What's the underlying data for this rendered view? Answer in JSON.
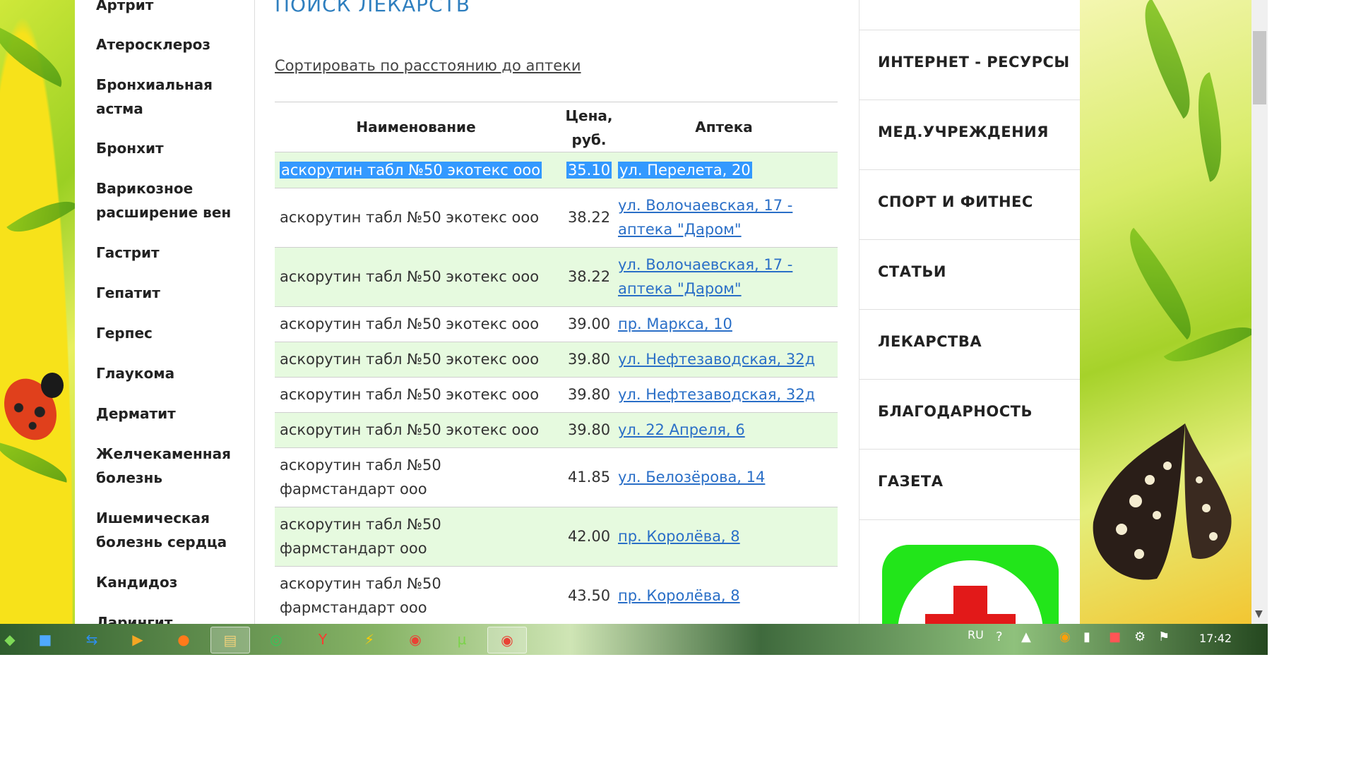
{
  "sidebar": {
    "items": [
      {
        "label": "Артрит"
      },
      {
        "label": "Атеросклероз"
      },
      {
        "label": "Бронхиальная астма"
      },
      {
        "label": "Бронхит"
      },
      {
        "label": "Варикозное расширение вен"
      },
      {
        "label": "Гастрит"
      },
      {
        "label": "Гепатит"
      },
      {
        "label": "Герпес"
      },
      {
        "label": "Глаукома"
      },
      {
        "label": "Дерматит"
      },
      {
        "label": "Желчекаменная болезнь"
      },
      {
        "label": "Ишемическая болезнь сердца"
      },
      {
        "label": "Кандидоз"
      },
      {
        "label": "Ларингит"
      }
    ]
  },
  "main": {
    "title": "ПОИСК ЛЕКАРСТВ",
    "sort_link": "Сортировать по расстоянию до аптеки",
    "table": {
      "headers": {
        "name": "Наименование",
        "price": "Цена, руб.",
        "pharmacy": "Аптека"
      },
      "rows": [
        {
          "name": "аскорутин табл №50 экотекс ооо",
          "price": "35.10",
          "pharmacy": "ул. Перелета, 20",
          "selected": true
        },
        {
          "name": "аскорутин табл №50 экотекс ооо",
          "price": "38.22",
          "pharmacy": "ул. Волочаевская, 17 - аптека \"Даром\""
        },
        {
          "name": "аскорутин табл №50 экотекс ооо",
          "price": "38.22",
          "pharmacy": "ул. Волочаевская, 17 - аптека \"Даром\""
        },
        {
          "name": "аскорутин табл №50 экотекс ооо",
          "price": "39.00",
          "pharmacy": "пр. Маркса, 10"
        },
        {
          "name": "аскорутин табл №50 экотекс ооо",
          "price": "39.80",
          "pharmacy": "ул. Нефтезаводская, 32д"
        },
        {
          "name": "аскорутин табл №50 экотекс ооо",
          "price": "39.80",
          "pharmacy": "ул. Нефтезаводская, 32д"
        },
        {
          "name": "аскорутин табл №50 экотекс ооо",
          "price": "39.80",
          "pharmacy": "ул. 22 Апреля, 6"
        },
        {
          "name": "аскорутин табл №50 фармстандарт ооо",
          "price": "41.85",
          "pharmacy": "ул. Белозёрова, 14"
        },
        {
          "name": "аскорутин табл №50 фармстандарт ооо",
          "price": "42.00",
          "pharmacy": "пр. Королёва, 8"
        },
        {
          "name": "аскорутин табл №50 фармстандарт ооо",
          "price": "43.50",
          "pharmacy": "пр. Королёва, 8"
        }
      ]
    }
  },
  "right_menu": {
    "items": [
      {
        "label": "ИНТЕРНЕТ - РЕСУРСЫ"
      },
      {
        "label": "МЕД.УЧРЕЖДЕНИЯ"
      },
      {
        "label": "СПОРТ И ФИТНЕС"
      },
      {
        "label": "СТАТЬИ"
      },
      {
        "label": "ЛЕКАРСТВА"
      },
      {
        "label": "БЛАГОДАРНОСТЬ"
      },
      {
        "label": "ГАЗЕТА"
      }
    ],
    "app_icon": "medical-cross-icon"
  },
  "taskbar": {
    "apps": [
      "windows-start-icon",
      "finder-icon",
      "teamviewer-icon",
      "media-player-icon",
      "opera-icon",
      "file-explorer-icon",
      "green-app-icon",
      "yandex-browser-icon",
      "winamp-icon",
      "chrome-icon",
      "utorrent-icon",
      "chrome-icon"
    ],
    "language": "RU",
    "clock": "17:42"
  },
  "colors": {
    "link": "#2a6fc7",
    "title": "#2f7fbf",
    "row_alt": "#e6fadf",
    "selection": "#3399ff"
  }
}
